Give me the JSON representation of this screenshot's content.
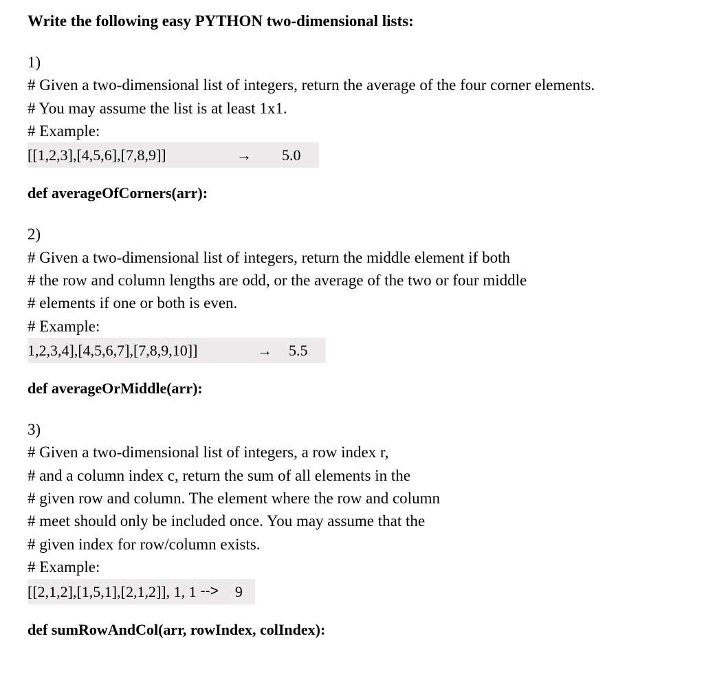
{
  "title": "Write the following easy PYTHON two-dimensional lists:",
  "problems": [
    {
      "num": "1)",
      "lines": [
        "# Given a two-dimensional list of integers, return the average of the four corner elements.",
        "# You may assume the list is at least 1x1.",
        "# Example:"
      ],
      "example_input": "[[1,2,3],[4,5,6],[7,8,9]]",
      "arrow": "→",
      "example_output": "5.0",
      "def": "def averageOfCorners(arr):"
    },
    {
      "num": "2)",
      "lines": [
        "# Given a two-dimensional list of integers, return the middle element if both",
        "# the row and column lengths are odd, or the average of the two or four middle",
        "# elements if one or both is even.",
        "# Example:"
      ],
      "example_input": "1,2,3,4],[4,5,6,7],[7,8,9,10]]",
      "arrow": "→",
      "example_output": "5.5",
      "def": "def averageOrMiddle(arr):"
    },
    {
      "num": "3)",
      "lines": [
        "# Given a two-dimensional list of integers, a row index r,",
        "# and a column index c, return the sum of all elements in the",
        "# given row and column. The element where the row and column",
        "# meet should only be included once. You may assume that the",
        "# given index for row/column exists.",
        "# Example:"
      ],
      "example_input": "[[2,1,2],[1,5,1],[2,1,2]], 1, 1",
      "arrow": "-->",
      "example_output": "9",
      "def": "def sumRowAndCol(arr, rowIndex, colIndex):"
    }
  ]
}
